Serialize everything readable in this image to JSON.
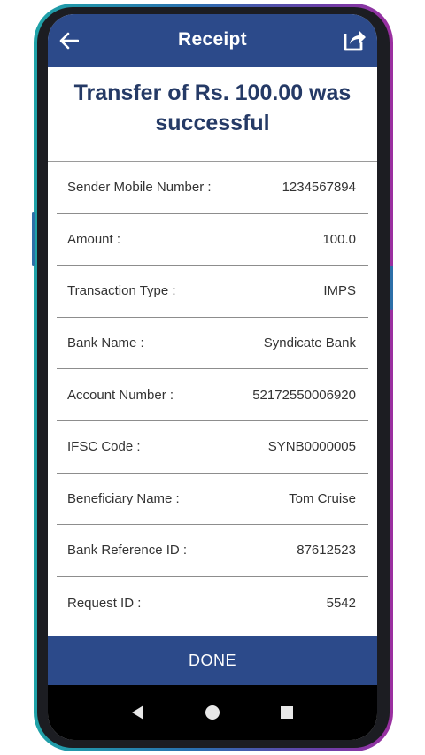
{
  "appbar": {
    "title": "Receipt",
    "back_icon": "arrow-left-icon",
    "share_icon": "share-icon"
  },
  "heading": "Transfer of Rs. 100.00 was successful",
  "details": [
    {
      "label": "Sender Mobile Number :",
      "value": "1234567894"
    },
    {
      "label": "Amount :",
      "value": "100.0"
    },
    {
      "label": "Transaction Type :",
      "value": "IMPS"
    },
    {
      "label": "Bank Name :",
      "value": "Syndicate Bank"
    },
    {
      "label": "Account Number :",
      "value": "52172550006920"
    },
    {
      "label": "IFSC Code :",
      "value": "SYNB0000005"
    },
    {
      "label": "Beneficiary Name :",
      "value": "Tom Cruise"
    },
    {
      "label": "Bank Reference ID :",
      "value": "87612523"
    },
    {
      "label": "Request ID :",
      "value": "5542"
    }
  ],
  "done_label": "DONE",
  "navbar": {
    "back_icon": "nav-back-icon",
    "home_icon": "nav-home-icon",
    "recents_icon": "nav-recents-icon"
  },
  "colors": {
    "primary": "#2c4a8a",
    "heading_text": "#253a66",
    "frame_gradient_start": "#1fa3a8",
    "frame_gradient_end": "#9b2fa0"
  }
}
